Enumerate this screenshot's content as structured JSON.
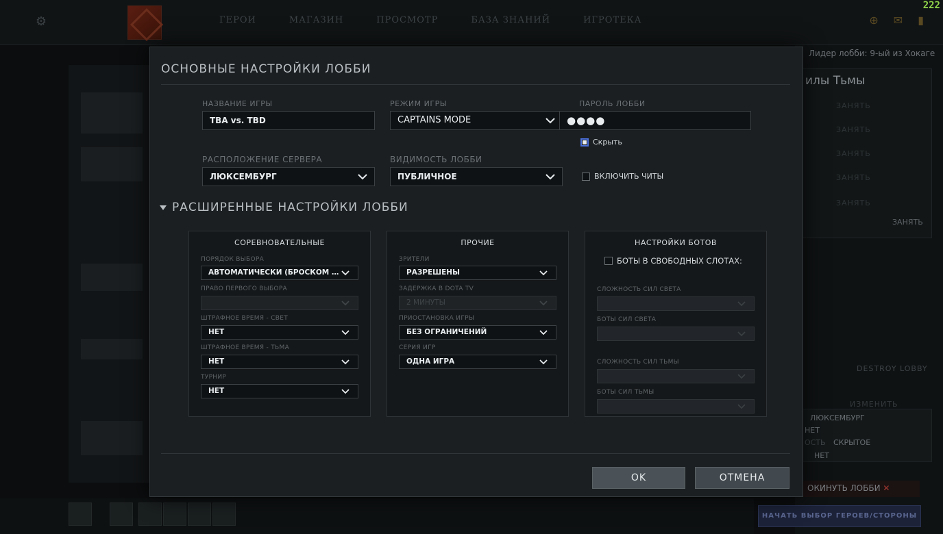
{
  "background": {
    "nav": [
      "ГЕРОИ",
      "МАГАЗИН",
      "ПРОСМОТР",
      "БАЗА ЗНАНИЙ",
      "ИГРОТЕКА"
    ],
    "fps": "222",
    "lobby_leader": "Лидер лобби: 9-ый из Хокаге",
    "dire_title": "илы Тьмы",
    "slot_label": "ЗАНЯТЬ",
    "side_take": "ЗАНЯТЬ",
    "destroy_lobby": "DESTROY LOBBY",
    "change": "ИЗМЕНИТЬ",
    "info_server": "ЛЮКСЕМБУРГ",
    "info_no1": "НЕТ",
    "info_visibility_label": "ОСТЬ",
    "info_visibility": "СКРЫТОЕ",
    "info_no2": "НЕТ",
    "leave_lobby": "ОКИНУТЬ ЛОББИ",
    "start_pick": "НАЧАТЬ ВЫБОР ГЕРОЕВ/СТОРОНЫ"
  },
  "modal": {
    "title": "ОСНОВНЫЕ НАСТРОЙКИ ЛОББИ",
    "game_name": {
      "label": "НАЗВАНИЕ ИГРЫ",
      "value": "TBA vs. TBD"
    },
    "game_mode": {
      "label": "РЕЖИМ ИГРЫ",
      "value": "CAPTAINS MODE"
    },
    "password": {
      "label": "ПАРОЛЬ ЛОББИ",
      "value": "●●●●",
      "hide_label": "Скрыть",
      "hide_checked": true
    },
    "server": {
      "label": "РАСПОЛОЖЕНИЕ СЕРВЕРА",
      "value": "ЛЮКСЕМБУРГ"
    },
    "visibility": {
      "label": "ВИДИМОСТЬ ЛОББИ",
      "value": "ПУБЛИЧНОЕ"
    },
    "cheats": {
      "label": "ВКЛЮЧИТЬ ЧИТЫ",
      "checked": false
    },
    "advanced_title": "РАСШИРЕННЫЕ НАСТРОЙКИ ЛОББИ",
    "competitive": {
      "title": "СОРЕВНОВАТЕЛЬНЫЕ",
      "pick_order_label": "ПОРЯДОК ВЫБОРА",
      "pick_order_value": "АВТОМАТИЧЕСКИ (БРОСКОМ МОНЕТЫ)",
      "first_pick_label": "ПРАВО ПЕРВОГО ВЫБОРА",
      "first_pick_value": "",
      "penalty_radiant_label": "ШТРАФНОЕ ВРЕМЯ - СВЕТ",
      "penalty_radiant_value": "НЕТ",
      "penalty_dire_label": "ШТРАФНОЕ ВРЕМЯ - ТЬМА",
      "penalty_dire_value": "НЕТ",
      "tournament_label": "ТУРНИР",
      "tournament_value": "НЕТ"
    },
    "other": {
      "title": "ПРОЧИЕ",
      "spectators_label": "ЗРИТЕЛИ",
      "spectators_value": "РАЗРЕШЕНЫ",
      "tv_delay_label": "ЗАДЕРЖКА В DOTA TV",
      "tv_delay_value": "2 МИНУТЫ",
      "pause_label": "ПРИОСТАНОВКА ИГРЫ",
      "pause_value": "БЕЗ ОГРАНИЧЕНИЙ",
      "series_label": "СЕРИЯ ИГР",
      "series_value": "ОДНА ИГРА"
    },
    "bots": {
      "title": "НАСТРОЙКИ БОТОВ",
      "fill_label": "БОТЫ В СВОБОДНЫХ СЛОТАХ:",
      "fill_checked": false,
      "radiant_difficulty_label": "СЛОЖНОСТЬ СИЛ СВЕТА",
      "radiant_bots_label": "БОТЫ СИЛ СВЕТА",
      "dire_difficulty_label": "СЛОЖНОСТЬ СИЛ ТЬМЫ",
      "dire_bots_label": "БОТЫ СИЛ ТЬМЫ"
    },
    "ok": "OK",
    "cancel": "ОТМЕНА"
  }
}
